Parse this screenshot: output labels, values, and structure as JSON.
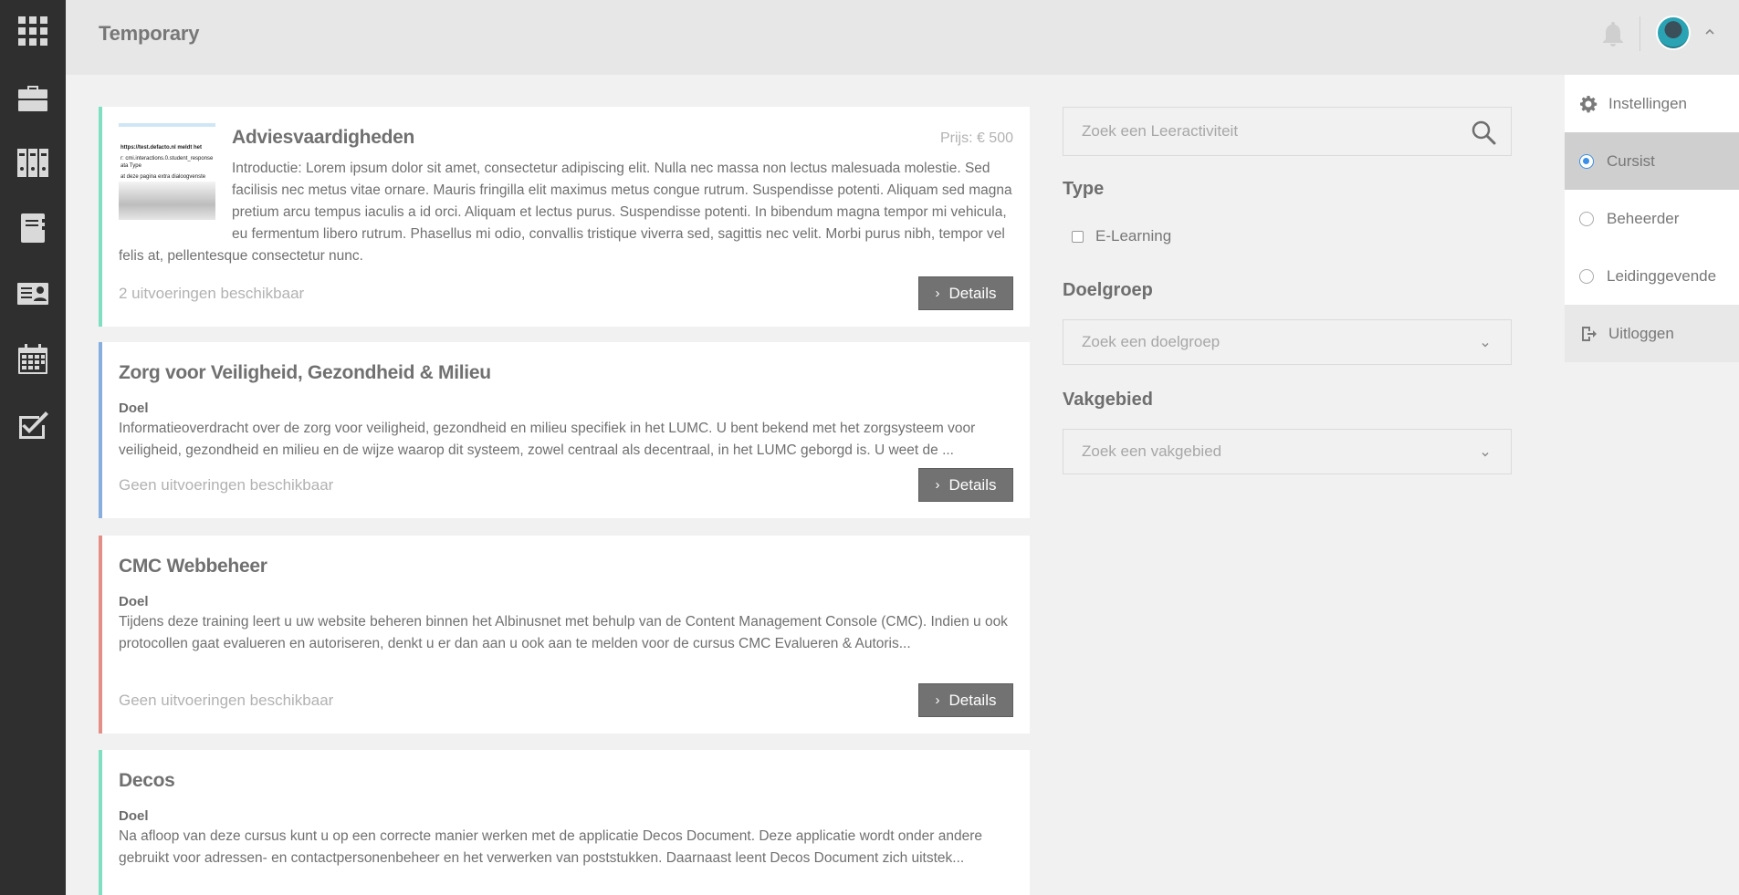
{
  "header": {
    "title": "Temporary"
  },
  "sidebar": {
    "icons": [
      "apps-grid-icon",
      "briefcase-icon",
      "binders-icon",
      "notebook-icon",
      "contact-card-icon",
      "calendar-icon",
      "checklist-icon"
    ]
  },
  "user_menu": {
    "settings_label": "Instellingen",
    "roles": [
      {
        "label": "Cursist",
        "selected": true
      },
      {
        "label": "Beheerder",
        "selected": false
      },
      {
        "label": "Leidinggevende",
        "selected": false
      }
    ],
    "logout_label": "Uitloggen"
  },
  "courses": [
    {
      "title": "Adviesvaardigheden",
      "price": "Prijs: € 500",
      "text": "Introductie: Lorem ipsum dolor sit amet, consectetur adipiscing elit. Nulla nec massa non lectus malesuada molestie. Sed facilisis nec metus vitae ornare. Mauris fringilla elit maximus metus congue rutrum. Suspendisse potenti. Aliquam sed magna pretium arcu tempus iaculis a id orci. Aliquam et lectus purus. Suspendisse potenti. In bibendum magna tempor mi vehicula, eu fermentum libero rutrum. Phasellus mi odio, convallis tristique viverra sed, sagittis nec velit. Morbi purus nibh, tempor vel felis at, pellentesque consectetur nunc.",
      "availability": "2 uitvoeringen beschikbaar",
      "button": "Details",
      "thumb_lines": [
        "https://test.defacto.nl meldt het",
        "r: cmi.interactions.0.student_response",
        "ata Type",
        "at deze pagina extra dialoogvenste"
      ],
      "accent": "#7ee0c0"
    },
    {
      "title": "Zorg voor Veiligheid, Gezondheid & Milieu",
      "subhead": "Doel",
      "text": "Informatieoverdracht over de zorg voor veiligheid, gezondheid en milieu specifiek in het LUMC. U bent bekend met het zorgsysteem voor veiligheid, gezondheid en milieu en de wijze waarop dit systeem, zowel centraal als decentraal, in het LUMC geborgd is. U weet de ...",
      "availability": "Geen uitvoeringen beschikbaar",
      "button": "Details",
      "accent": "#86aede"
    },
    {
      "title": "CMC Webbeheer",
      "subhead": "Doel",
      "text": "Tijdens deze training leert u uw website beheren binnen het Albinusnet met behulp van de Content Management Console (CMC). Indien u ook protocollen gaat evalueren en autoriseren, denkt u er dan aan u ook aan te melden voor de cursus CMC Evalueren & Autoris...",
      "availability": "Geen uitvoeringen beschikbaar",
      "button": "Details",
      "accent": "#e38f87"
    },
    {
      "title": "Decos",
      "subhead": "Doel",
      "text": "Na afloop van deze cursus kunt u op een correcte manier werken met de applicatie Decos Document. Deze applicatie wordt onder andere gebruikt voor adressen- en contactpersonenbeheer en het verwerken van poststukken. Daarnaast leent Decos Document zich uitstek...",
      "accent": "#7ee0c0"
    }
  ],
  "filters": {
    "search_placeholder": "Zoek een Leeractiviteit",
    "type_heading": "Type",
    "type_option": "E-Learning",
    "doelgroep_heading": "Doelgroep",
    "doelgroep_placeholder": "Zoek een doelgroep",
    "vakgebied_heading": "Vakgebied",
    "vakgebied_placeholder": "Zoek een vakgebied"
  }
}
